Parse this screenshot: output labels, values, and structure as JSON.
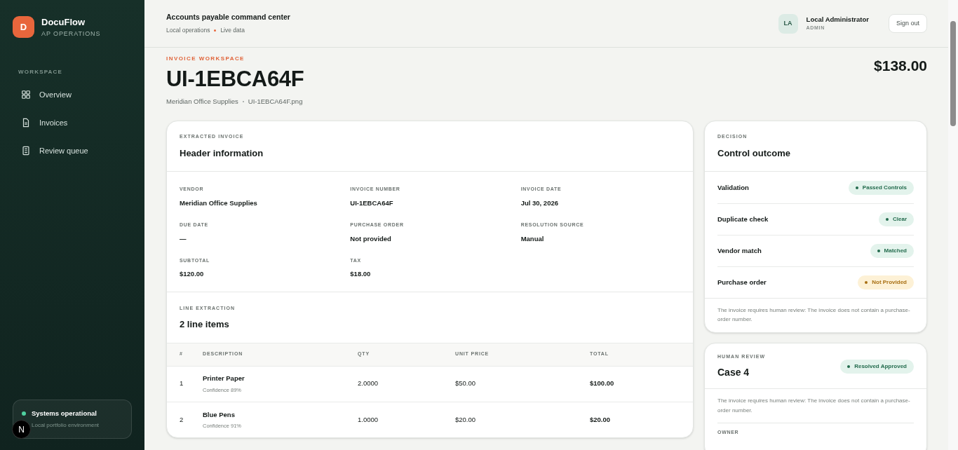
{
  "brand": {
    "logo_letter": "D",
    "name": "DocuFlow",
    "subtitle": "AP OPERATIONS"
  },
  "sidebar": {
    "section": "WORKSPACE",
    "items": [
      {
        "label": "Overview",
        "kind": "grid",
        "selected": false
      },
      {
        "label": "Invoices",
        "kind": "file",
        "selected": false
      },
      {
        "label": "Review queue",
        "kind": "list",
        "selected": false
      }
    ],
    "status": {
      "title": "Systems operational",
      "subtitle": "Local portfolio environment",
      "color": "#4fd1a0"
    }
  },
  "dev_badge": {
    "label": "N"
  },
  "topbar": {
    "title": "Accounts payable command center",
    "meta": [
      "Local operations",
      "Live data"
    ],
    "user": {
      "initials": "LA",
      "name": "Local Administrator",
      "role": "ADMIN"
    },
    "sign_out": "Sign out"
  },
  "page": {
    "eyebrow": "INVOICE WORKSPACE",
    "title": "UI-1EBCA64F",
    "subtitle": [
      "Meridian Office Supplies",
      "UI-1EBCA64F.png"
    ],
    "amount": "$138.00"
  },
  "header_card": {
    "eyebrow": "EXTRACTED INVOICE",
    "title": "Header information",
    "fields": [
      {
        "label": "VENDOR",
        "value": "Meridian Office Supplies"
      },
      {
        "label": "INVOICE NUMBER",
        "value": "UI-1EBCA64F"
      },
      {
        "label": "INVOICE DATE",
        "value": "Jul 30, 2026"
      },
      {
        "label": "DUE DATE",
        "value": "—"
      },
      {
        "label": "PURCHASE ORDER",
        "value": "Not provided"
      },
      {
        "label": "RESOLUTION SOURCE",
        "value": "Manual"
      },
      {
        "label": "SUBTOTAL",
        "value": "$120.00"
      },
      {
        "label": "TAX",
        "value": "$18.00"
      }
    ]
  },
  "lines_card": {
    "eyebrow": "LINE EXTRACTION",
    "title": "2 line items",
    "columns": [
      "#",
      "DESCRIPTION",
      "QTY",
      "UNIT PRICE",
      "TOTAL"
    ],
    "rows": [
      {
        "index": "1",
        "description": "Printer Paper",
        "confidence": "Confidence 89%",
        "qty": "2.0000",
        "unit_price": "$50.00",
        "total": "$100.00"
      },
      {
        "index": "2",
        "description": "Blue Pens",
        "confidence": "Confidence 91%",
        "qty": "1.0000",
        "unit_price": "$20.00",
        "total": "$20.00"
      }
    ]
  },
  "decision_card": {
    "eyebrow": "DECISION",
    "title": "Control outcome",
    "checks": [
      {
        "label": "Validation",
        "status": "Passed Controls",
        "kind": "success"
      },
      {
        "label": "Duplicate check",
        "status": "Clear",
        "kind": "success"
      },
      {
        "label": "Vendor match",
        "status": "Matched",
        "kind": "success"
      },
      {
        "label": "Purchase order",
        "status": "Not Provided",
        "kind": "warning"
      }
    ],
    "note": "The invoice requires human review: The invoice does not contain a purchase-order number."
  },
  "review_card": {
    "eyebrow": "HUMAN REVIEW",
    "title": "Case 4",
    "status": {
      "label": "Resolved Approved",
      "kind": "success"
    },
    "note": "The invoice requires human review: The invoice does not contain a purchase-order number.",
    "field_label": "OWNER"
  }
}
